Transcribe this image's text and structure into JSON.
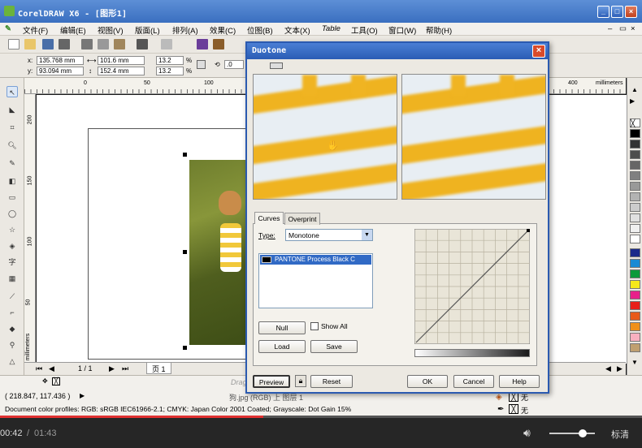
{
  "app": {
    "title": "CorelDRAW X6 - [图形1]"
  },
  "menu": [
    "文件(F)",
    "编辑(E)",
    "视图(V)",
    "版面(L)",
    "排列(A)",
    "效果(C)",
    "位图(B)",
    "文本(X)",
    "Table",
    "工具(O)",
    "窗口(W)",
    "帮助(H)"
  ],
  "propbar": {
    "x": "135.768 mm",
    "y": "93.094 mm",
    "w": "101.6 mm",
    "h": "152.4 mm",
    "sx": "13.2",
    "sy": "13.2",
    "pct": "%",
    "rot": ".0",
    "x_label": "x:",
    "y_label": "y:"
  },
  "rulers": {
    "h_ticks": [
      "0",
      "50",
      "100",
      "400"
    ],
    "h_unit": "millimeters",
    "v_ticks": [
      "200",
      "150",
      "100",
      "50"
    ],
    "v_unit": "millimeters"
  },
  "pagenav": {
    "page": "1 / 1",
    "tab": "页 1"
  },
  "status": {
    "coords": "( 218.847, 117.436 )",
    "profiles": "Document color profiles: RGB: sRGB IEC61966-2.1; CMYK: Japan Color 2001 Coated; Grayscale: Dot Gain 15%",
    "object_info": "狗.jpg (RGB) 上 图层 1",
    "fill_none": "无",
    "outline_none": "无",
    "drag_hint": "Drag"
  },
  "player": {
    "time_current": "00:42",
    "time_sep": "/",
    "time_total": "01:43",
    "quality": "标清"
  },
  "dialog": {
    "title": "Duotone",
    "tabs": [
      "Curves",
      "Overprint"
    ],
    "type_label": "Type:",
    "type_value": "Monotone",
    "ink": "PANTONE Process Black C",
    "null_btn": "Null",
    "show_all": "Show All",
    "load_btn": "Load",
    "save_btn": "Save",
    "preview_btn": "Preview",
    "reset_btn": "Reset",
    "ok_btn": "OK",
    "cancel_btn": "Cancel",
    "help_btn": "Help"
  },
  "colors": {
    "accent": "#2a5cb5",
    "stripe": "#efb320",
    "curve": "#555555"
  },
  "progress": {
    "played_fraction": 0.41
  }
}
